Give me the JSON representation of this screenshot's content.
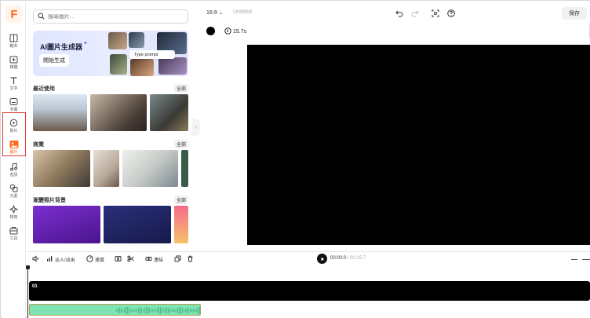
{
  "app": {
    "logo": "F"
  },
  "rail": {
    "items": [
      {
        "label": "範本",
        "icon": "template-icon"
      },
      {
        "label": "媒體",
        "icon": "media-upload-icon"
      },
      {
        "label": "文字",
        "icon": "text-icon"
      },
      {
        "label": "字幕",
        "icon": "subtitle-icon"
      },
      {
        "label": "影片",
        "icon": "video-icon"
      },
      {
        "label": "圖片",
        "icon": "image-icon",
        "active": true
      },
      {
        "label": "音訊",
        "icon": "music-icon"
      },
      {
        "label": "元素",
        "icon": "elements-icon"
      },
      {
        "label": "特效",
        "icon": "effects-icon"
      },
      {
        "label": "工具",
        "icon": "tools-icon"
      }
    ]
  },
  "panel": {
    "search_placeholder": "搜尋圖片...",
    "banner": {
      "title": "AI圖片生成器",
      "button": "開始生成",
      "prompt": "Type prompt"
    },
    "sections": [
      {
        "title": "最近使用",
        "all": "全部"
      },
      {
        "title": "商業",
        "all": "全部"
      },
      {
        "title": "漸變照片背景",
        "all": "全部"
      }
    ]
  },
  "topbar": {
    "ratio": "16:9",
    "title": "Untitled",
    "save": "保存"
  },
  "subbar": {
    "duration": "15.7s"
  },
  "timeline": {
    "volume_icon": "speaker-icon",
    "fade": "淡入/淡出",
    "speed": "速度",
    "link": "連結",
    "current_time": "00:00.0",
    "total_time": "/ 00:15.7",
    "track_label": "01"
  },
  "colors": {
    "accent": "#ff6a1a",
    "highlight": "#e53935",
    "audio": "#7fe3b4"
  }
}
